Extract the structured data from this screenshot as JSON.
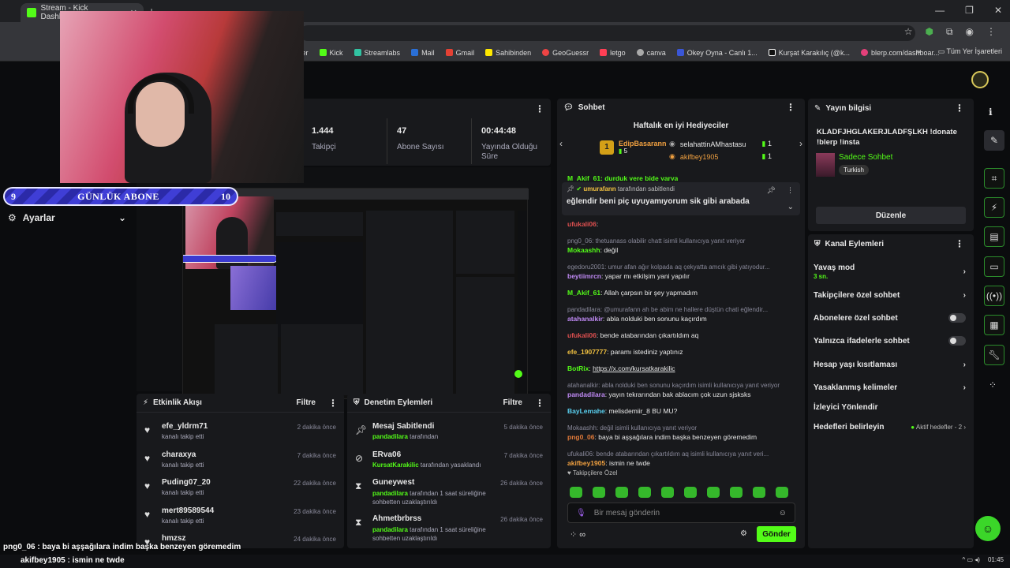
{
  "browser": {
    "tab_title": "Stream - Kick Dashboard",
    "bookmarks": [
      "ter",
      "Kick",
      "Streamlabs",
      "Mail",
      "Gmail",
      "Sahibinden",
      "GeoGuessr",
      "letgo",
      "canva",
      "Okey Oyna - Canlı 1...",
      "Kurşat Karakılıç (@k...",
      "blerp.com/dashboar..."
    ],
    "bookmarks_all": "Tüm Yer İşaretleri"
  },
  "overlay": {
    "abone_left": "9",
    "abone_title": "GÜNLÜK ABONE",
    "abone_right": "10",
    "bottom_chat_1": "png0_06 : baya bi aşşağılara indim başka benzeyen göremedim",
    "bottom_chat_2": "akifbey1905 : ismin ne twde"
  },
  "sidebar": {
    "settings_label": "Ayarlar"
  },
  "stats": {
    "followers_value": "1.444",
    "followers_label": "Takipçi",
    "subs_value": "47",
    "subs_label": "Abone Sayısı",
    "uptime_value": "00:44:48",
    "uptime_label": "Yayında Olduğu Süre"
  },
  "activity": {
    "title": "Etkinlik Akışı",
    "filter": "Filtre",
    "items": [
      {
        "name": "efe_yldrm71",
        "sub": "kanalı takip etti",
        "time": "2 dakika önce"
      },
      {
        "name": "charaxya",
        "sub": "kanalı takip etti",
        "time": "7 dakika önce"
      },
      {
        "name": "Puding07_20",
        "sub": "kanalı takip etti",
        "time": "22 dakika önce"
      },
      {
        "name": "mert89589544",
        "sub": "kanalı takip etti",
        "time": "23 dakika önce"
      },
      {
        "name": "hmzsz",
        "sub": "",
        "time": "24 dakika önce"
      }
    ]
  },
  "moderation": {
    "title": "Denetim Eylemleri",
    "filter": "Filtre",
    "items": [
      {
        "name": "Mesaj Sabitlendi",
        "actor": "pandadilara",
        "rest": " tarafından",
        "time": "5 dakika önce"
      },
      {
        "name": "ERva06",
        "actor": "KursatKarakilic",
        "rest": " tarafından yasaklandı",
        "time": "7 dakika önce"
      },
      {
        "name": "Guneywest",
        "actor": "pandadilara",
        "rest": " tarafından 1 saat süreliğine sohbetten uzaklaştırıldı",
        "time": "26 dakika önce"
      },
      {
        "name": "Ahmetbrbrss",
        "actor": "pandadilara",
        "rest": " tarafından 1 saat süreliğine sohbetten uzaklaştırıldı",
        "time": "26 dakika önce"
      }
    ]
  },
  "chat": {
    "title": "Sohbet",
    "gifters_title": "Haftalık en iyi Hediyeciler",
    "top_gifter_rank": "1",
    "top_gifter": "EdipBasarann",
    "top_gifter_count": "5",
    "gifter2": "selahattinAMhastasu",
    "gifter2_count": "1",
    "gifter3": "akifbey1905",
    "gifter3_count": "1",
    "cut_line": "M_Akif_61: durduk yere bide yarya",
    "pinned_by": "umurafann",
    "pinned_suffix": "tarafından sabitlendi",
    "pinned_msg": "eğlendir beni piç uyuyamıyorum sik gibi arabada",
    "messages": [
      {
        "reply": "",
        "user": "ufukali06",
        "color": "#e05050",
        "text": ""
      },
      {
        "reply": "png0_06: thetuanass olabilir chatt isimli kullanıcıya yanıt veriyor",
        "user": "Mokaashh",
        "color": "#53fc18",
        "text": "değil"
      },
      {
        "reply": "egedoru2001: umur afan ağır kolpada aq çekyatta amcık gibi yatıyodur...",
        "user": "beytiimrcn",
        "color": "#c08af5",
        "text": "yapar mı etkilşim yani yapılır"
      },
      {
        "reply": "",
        "user": "M_Akif_61",
        "color": "#53fc18",
        "text": "Allah çarpsın bir şey yapmadım"
      },
      {
        "reply": "pandadilara: @umurafann ah be abim ne hallere düştün chati eğlendir...",
        "user": "atahanalkir",
        "color": "#c08af5",
        "text": "abla nolduki ben sonunu kaçırdım"
      },
      {
        "reply": "",
        "user": "ufukali06",
        "color": "#e05050",
        "text": "bende atabarından çıkartıldım aq"
      },
      {
        "reply": "",
        "user": "efe_1907777",
        "color": "#f0c040",
        "text": "paramı istediniz yaptınız"
      },
      {
        "reply": "",
        "user": "BotRix",
        "color": "#53fc18",
        "text": "https://x.com/kursatkarakilic"
      },
      {
        "reply": "atahanalkir: abla nolduki ben sonunu kaçırdım isimli kullanıcıya yanıt veriyor",
        "user": "pandadilara",
        "color": "#c08af5",
        "text": "yayın tekrarından bak ablacım çok uzun sjsksks"
      },
      {
        "reply": "",
        "user": "BayLemahe",
        "color": "#5ad0f0",
        "text": "melisdemiir_8 BU MU?"
      },
      {
        "reply": "Mokaashh: değil isimli kullanıcıya yanıt veriyor",
        "user": "png0_06",
        "color": "#e07a3a",
        "text": "baya bi aşşağılara indim başka benzeyen göremedim"
      },
      {
        "reply": "ufukali06: bende atabarından çıkartıldım aq isimli kullanıcıya yanıt veri...",
        "user": "akifbey1905",
        "color": "#f0a040",
        "text": "ismin ne twde"
      }
    ],
    "followers_only": "Takipçilere Özel",
    "input_placeholder": "Bir mesaj gönderin",
    "send": "Gönder"
  },
  "stream_info": {
    "title": "Yayın bilgisi",
    "stream_title": "KLADFJHGLAKERJLADFŞLKH !donate !blerp !insta",
    "category": "Sadece Sohbet",
    "tag": "Turkish",
    "edit": "Düzenle"
  },
  "channel_actions": {
    "title": "Kanal Eylemleri",
    "slow_mode": "Yavaş mod",
    "slow_mode_value": "3 sn.",
    "followers_chat": "Takipçilere özel sohbet",
    "subs_chat": "Abonelere özel sohbet",
    "emotes_chat": "Yalnızca ifadelerle sohbet",
    "account_age": "Hesap yaşı kısıtlaması",
    "banned_words": "Yasaklanmış kelimeler",
    "redirect": "İzleyici Yönlendir",
    "goals": "Hedefleri belirleyin",
    "goals_status": "Aktif hedefler - 2"
  },
  "taskbar": {
    "time": "01:45"
  }
}
